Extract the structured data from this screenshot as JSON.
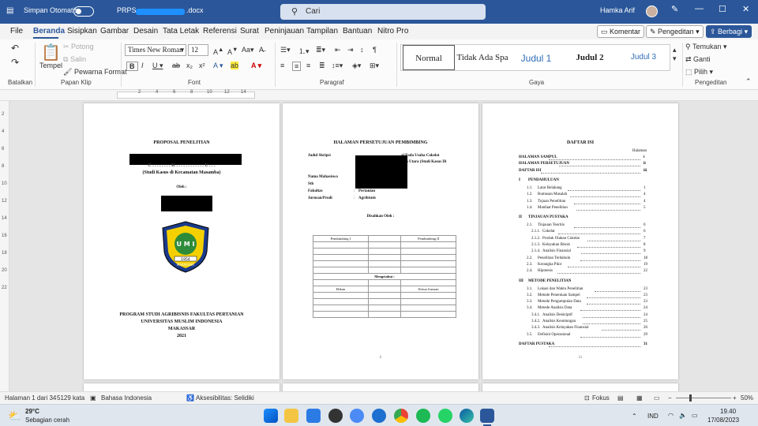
{
  "titlebar": {
    "autosave_label": "Simpan Otomatis",
    "filename_prefix": "PRPS",
    "filename_suffix": ".docx",
    "search_placeholder": "Cari",
    "user_name": "Hamka Arif"
  },
  "menu": {
    "tabs": [
      "File",
      "Beranda",
      "Sisipkan",
      "Gambar",
      "Desain",
      "Tata Letak",
      "Referensi",
      "Surat",
      "Peninjauan",
      "Tampilan",
      "Bantuan",
      "Nitro Pro"
    ],
    "comment_label": "Komentar",
    "editing_label": "Pengeditan",
    "share_label": "Berbagi"
  },
  "ribbon": {
    "undo_group": "Batalkan",
    "clipboard": {
      "group": "Papan Klip",
      "paste": "Tempel",
      "cut": "Potong",
      "copy": "Salin",
      "format_painter": "Pewarna Format"
    },
    "font": {
      "group": "Font",
      "name": "Times New Roman",
      "size": "12"
    },
    "paragraph_group": "Paragraf",
    "styles": {
      "group": "Gaya",
      "items": [
        "Normal",
        "Tidak Ada Spa",
        "Judul 1",
        "Judul 2",
        "Judul 3"
      ]
    },
    "editing": {
      "group": "Pengeditan",
      "find": "Temukan",
      "replace": "Ganti",
      "select": "Pilih"
    }
  },
  "page1": {
    "title": "PROPOSAL PENELITIAN",
    "subtitle_partial": "C . . . . . . . . K . . . . . . . . . . . . U . . .",
    "case_study": "(Studi Kasus di Kecamatan Masamba)",
    "by": "Oleh :",
    "logo_text": "MAKASSAR",
    "logo_year": "1954",
    "program": "PROGRAM STUDI AGRIBISNIS FAKULTAS PERTANIAN",
    "university": "UNIVERSITAS MUSLIM INDONESIA",
    "city": "MAKASSAR",
    "year": "2021"
  },
  "page2": {
    "title": "HALAMAN PERSETUJUAN PEMBIMBING",
    "thesis_label": "Judul Skripsi",
    "thesis_value_a": "al  Pada  Usaha  Cokelat",
    "thesis_value_b": "n Utara (Studi Kasus Di",
    "student_label": "Nama Mahasiswa",
    "sid_label": "Stb",
    "faculty_label": "Fakultas",
    "faculty_value": "Pertanian",
    "dept_label": "Jurusan/Prodi",
    "dept_value": "Agribisnis",
    "approved_by": "Disahkan Oleh :",
    "advisor1": "Pembimbing I",
    "advisor2": "Pembimbing II",
    "knowing": "Mengetahui :",
    "dean": "Dekan",
    "head": "Ketua Jurusan",
    "page_no": "ii"
  },
  "page3": {
    "title": "DAFTAR ISI",
    "page_header": "Halaman",
    "entries": [
      {
        "num": "",
        "text": "HALAMAN SAMPUL",
        "page": "i",
        "bold": true,
        "indent": 0
      },
      {
        "num": "",
        "text": "HALAMAN PERSETUJUAN",
        "page": "ii",
        "bold": true,
        "indent": 0
      },
      {
        "num": "",
        "text": "DAFTAR ISI",
        "page": "iii",
        "bold": true,
        "indent": 0
      },
      {
        "num": "I",
        "text": "PENDAHULUAN",
        "page": "",
        "bold": true,
        "indent": 0
      },
      {
        "num": "1.1.",
        "text": "Latar Belakang",
        "page": "1",
        "bold": false,
        "indent": 1
      },
      {
        "num": "1.2.",
        "text": "Rumusan Masalah",
        "page": "4",
        "bold": false,
        "indent": 1
      },
      {
        "num": "1.3.",
        "text": "Tujuan Penelitian",
        "page": "4",
        "bold": false,
        "indent": 1
      },
      {
        "num": "1.4.",
        "text": "Manfaat Penelitian",
        "page": "5",
        "bold": false,
        "indent": 1
      },
      {
        "num": "II",
        "text": "TINJAUAN PUSTAKA",
        "page": "",
        "bold": true,
        "indent": 0
      },
      {
        "num": "2.1.",
        "text": "Tinjauan Teoritis",
        "page": "6",
        "bold": false,
        "indent": 1
      },
      {
        "num": "2.1.1.",
        "text": "Cokelat",
        "page": "6",
        "bold": false,
        "indent": 2
      },
      {
        "num": "2.1.2.",
        "text": "Produk Olahan Cokelat",
        "page": "7",
        "bold": false,
        "indent": 2
      },
      {
        "num": "2.1.3.",
        "text": "Kelayakan Bisnis",
        "page": "8",
        "bold": false,
        "indent": 2
      },
      {
        "num": "2.1.4.",
        "text": "Analisis Finansial",
        "page": "9",
        "bold": false,
        "indent": 2
      },
      {
        "num": "2.2.",
        "text": "Penelitian Terdahulu",
        "page": "18",
        "bold": false,
        "indent": 1
      },
      {
        "num": "2.3.",
        "text": "Kerangka Pikir",
        "page": "19",
        "bold": false,
        "indent": 1
      },
      {
        "num": "2.4.",
        "text": "Hipotesis",
        "page": "22",
        "bold": false,
        "indent": 1
      },
      {
        "num": "III",
        "text": "METODE PENELITIAN",
        "page": "",
        "bold": true,
        "indent": 0
      },
      {
        "num": "3.1.",
        "text": "Lokasi dan Waktu Penelitian",
        "page": "23",
        "bold": false,
        "indent": 1
      },
      {
        "num": "3.2.",
        "text": "Metode Penentuan Sampel",
        "page": "23",
        "bold": false,
        "indent": 1
      },
      {
        "num": "3.3.",
        "text": "Metode Pengumpulan Data",
        "page": "23",
        "bold": false,
        "indent": 1
      },
      {
        "num": "3.4.",
        "text": "Metode Analisis Data",
        "page": "24",
        "bold": false,
        "indent": 1
      },
      {
        "num": "3.4.1.",
        "text": "Analisis Deskriptif",
        "page": "24",
        "bold": false,
        "indent": 2
      },
      {
        "num": "3.4.2.",
        "text": "Analisis Keuntungan",
        "page": "25",
        "bold": false,
        "indent": 2
      },
      {
        "num": "3.4.3.",
        "text": "Analisis Kelayakan Finansial",
        "page": "26",
        "bold": false,
        "indent": 2
      },
      {
        "num": "3.5.",
        "text": "Defisini Operasional",
        "page": "29",
        "bold": false,
        "indent": 1
      },
      {
        "num": "",
        "text": "DAFTAR PUSTAKA",
        "page": "31",
        "bold": true,
        "indent": 0
      }
    ],
    "page_no": "iii"
  },
  "status": {
    "page": "Halaman 1 dari 34",
    "words": "5129 kata",
    "language": "Bahasa Indonesia",
    "accessibility": "Aksesibilitas: Selidiki",
    "focus": "Fokus",
    "zoom": "50%"
  },
  "taskbar": {
    "temperature": "29°C",
    "weather": "Sebagian cerah",
    "lang": "IND",
    "time": "19.40",
    "date": "17/08/2023"
  }
}
